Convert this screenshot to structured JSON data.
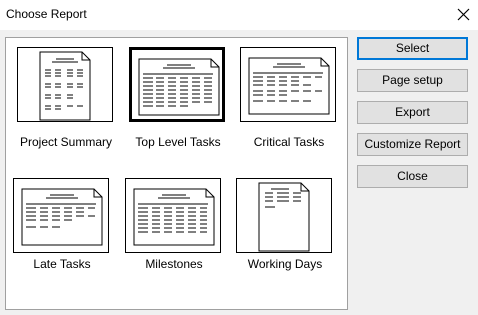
{
  "window": {
    "title": "Choose Report"
  },
  "reports": [
    {
      "label": "Project Summary",
      "selected": false
    },
    {
      "label": "Top Level Tasks",
      "selected": true
    },
    {
      "label": "Critical Tasks",
      "selected": false
    },
    {
      "label": "Late Tasks",
      "selected": false
    },
    {
      "label": "Milestones",
      "selected": false
    },
    {
      "label": "Working Days",
      "selected": false
    }
  ],
  "buttons": {
    "select": "Select",
    "page_setup": "Page setup",
    "export": "Export",
    "customize": "Customize Report",
    "close": "Close"
  },
  "icons": {
    "close": "close-icon",
    "thumbnail": "report-preview-icon"
  }
}
